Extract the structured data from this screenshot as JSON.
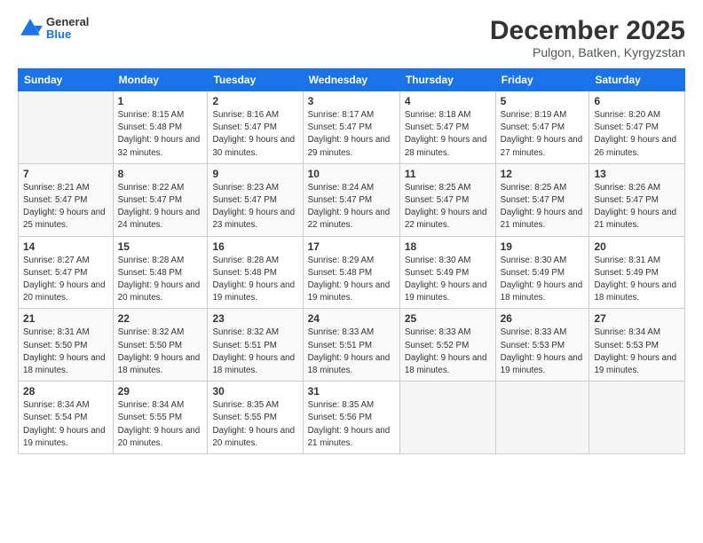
{
  "header": {
    "logo": {
      "general": "General",
      "blue": "Blue"
    },
    "title": "December 2025",
    "location": "Pulgon, Batken, Kyrgyzstan"
  },
  "days_of_week": [
    "Sunday",
    "Monday",
    "Tuesday",
    "Wednesday",
    "Thursday",
    "Friday",
    "Saturday"
  ],
  "weeks": [
    [
      {
        "day": "",
        "sunrise": "",
        "sunset": "",
        "daylight": ""
      },
      {
        "day": "1",
        "sunrise": "Sunrise: 8:15 AM",
        "sunset": "Sunset: 5:48 PM",
        "daylight": "Daylight: 9 hours and 32 minutes."
      },
      {
        "day": "2",
        "sunrise": "Sunrise: 8:16 AM",
        "sunset": "Sunset: 5:47 PM",
        "daylight": "Daylight: 9 hours and 30 minutes."
      },
      {
        "day": "3",
        "sunrise": "Sunrise: 8:17 AM",
        "sunset": "Sunset: 5:47 PM",
        "daylight": "Daylight: 9 hours and 29 minutes."
      },
      {
        "day": "4",
        "sunrise": "Sunrise: 8:18 AM",
        "sunset": "Sunset: 5:47 PM",
        "daylight": "Daylight: 9 hours and 28 minutes."
      },
      {
        "day": "5",
        "sunrise": "Sunrise: 8:19 AM",
        "sunset": "Sunset: 5:47 PM",
        "daylight": "Daylight: 9 hours and 27 minutes."
      },
      {
        "day": "6",
        "sunrise": "Sunrise: 8:20 AM",
        "sunset": "Sunset: 5:47 PM",
        "daylight": "Daylight: 9 hours and 26 minutes."
      }
    ],
    [
      {
        "day": "7",
        "sunrise": "Sunrise: 8:21 AM",
        "sunset": "Sunset: 5:47 PM",
        "daylight": "Daylight: 9 hours and 25 minutes."
      },
      {
        "day": "8",
        "sunrise": "Sunrise: 8:22 AM",
        "sunset": "Sunset: 5:47 PM",
        "daylight": "Daylight: 9 hours and 24 minutes."
      },
      {
        "day": "9",
        "sunrise": "Sunrise: 8:23 AM",
        "sunset": "Sunset: 5:47 PM",
        "daylight": "Daylight: 9 hours and 23 minutes."
      },
      {
        "day": "10",
        "sunrise": "Sunrise: 8:24 AM",
        "sunset": "Sunset: 5:47 PM",
        "daylight": "Daylight: 9 hours and 22 minutes."
      },
      {
        "day": "11",
        "sunrise": "Sunrise: 8:25 AM",
        "sunset": "Sunset: 5:47 PM",
        "daylight": "Daylight: 9 hours and 22 minutes."
      },
      {
        "day": "12",
        "sunrise": "Sunrise: 8:25 AM",
        "sunset": "Sunset: 5:47 PM",
        "daylight": "Daylight: 9 hours and 21 minutes."
      },
      {
        "day": "13",
        "sunrise": "Sunrise: 8:26 AM",
        "sunset": "Sunset: 5:47 PM",
        "daylight": "Daylight: 9 hours and 21 minutes."
      }
    ],
    [
      {
        "day": "14",
        "sunrise": "Sunrise: 8:27 AM",
        "sunset": "Sunset: 5:47 PM",
        "daylight": "Daylight: 9 hours and 20 minutes."
      },
      {
        "day": "15",
        "sunrise": "Sunrise: 8:28 AM",
        "sunset": "Sunset: 5:48 PM",
        "daylight": "Daylight: 9 hours and 20 minutes."
      },
      {
        "day": "16",
        "sunrise": "Sunrise: 8:28 AM",
        "sunset": "Sunset: 5:48 PM",
        "daylight": "Daylight: 9 hours and 19 minutes."
      },
      {
        "day": "17",
        "sunrise": "Sunrise: 8:29 AM",
        "sunset": "Sunset: 5:48 PM",
        "daylight": "Daylight: 9 hours and 19 minutes."
      },
      {
        "day": "18",
        "sunrise": "Sunrise: 8:30 AM",
        "sunset": "Sunset: 5:49 PM",
        "daylight": "Daylight: 9 hours and 19 minutes."
      },
      {
        "day": "19",
        "sunrise": "Sunrise: 8:30 AM",
        "sunset": "Sunset: 5:49 PM",
        "daylight": "Daylight: 9 hours and 18 minutes."
      },
      {
        "day": "20",
        "sunrise": "Sunrise: 8:31 AM",
        "sunset": "Sunset: 5:49 PM",
        "daylight": "Daylight: 9 hours and 18 minutes."
      }
    ],
    [
      {
        "day": "21",
        "sunrise": "Sunrise: 8:31 AM",
        "sunset": "Sunset: 5:50 PM",
        "daylight": "Daylight: 9 hours and 18 minutes."
      },
      {
        "day": "22",
        "sunrise": "Sunrise: 8:32 AM",
        "sunset": "Sunset: 5:50 PM",
        "daylight": "Daylight: 9 hours and 18 minutes."
      },
      {
        "day": "23",
        "sunrise": "Sunrise: 8:32 AM",
        "sunset": "Sunset: 5:51 PM",
        "daylight": "Daylight: 9 hours and 18 minutes."
      },
      {
        "day": "24",
        "sunrise": "Sunrise: 8:33 AM",
        "sunset": "Sunset: 5:51 PM",
        "daylight": "Daylight: 9 hours and 18 minutes."
      },
      {
        "day": "25",
        "sunrise": "Sunrise: 8:33 AM",
        "sunset": "Sunset: 5:52 PM",
        "daylight": "Daylight: 9 hours and 18 minutes."
      },
      {
        "day": "26",
        "sunrise": "Sunrise: 8:33 AM",
        "sunset": "Sunset: 5:53 PM",
        "daylight": "Daylight: 9 hours and 19 minutes."
      },
      {
        "day": "27",
        "sunrise": "Sunrise: 8:34 AM",
        "sunset": "Sunset: 5:53 PM",
        "daylight": "Daylight: 9 hours and 19 minutes."
      }
    ],
    [
      {
        "day": "28",
        "sunrise": "Sunrise: 8:34 AM",
        "sunset": "Sunset: 5:54 PM",
        "daylight": "Daylight: 9 hours and 19 minutes."
      },
      {
        "day": "29",
        "sunrise": "Sunrise: 8:34 AM",
        "sunset": "Sunset: 5:55 PM",
        "daylight": "Daylight: 9 hours and 20 minutes."
      },
      {
        "day": "30",
        "sunrise": "Sunrise: 8:35 AM",
        "sunset": "Sunset: 5:55 PM",
        "daylight": "Daylight: 9 hours and 20 minutes."
      },
      {
        "day": "31",
        "sunrise": "Sunrise: 8:35 AM",
        "sunset": "Sunset: 5:56 PM",
        "daylight": "Daylight: 9 hours and 21 minutes."
      },
      {
        "day": "",
        "sunrise": "",
        "sunset": "",
        "daylight": ""
      },
      {
        "day": "",
        "sunrise": "",
        "sunset": "",
        "daylight": ""
      },
      {
        "day": "",
        "sunrise": "",
        "sunset": "",
        "daylight": ""
      }
    ]
  ]
}
